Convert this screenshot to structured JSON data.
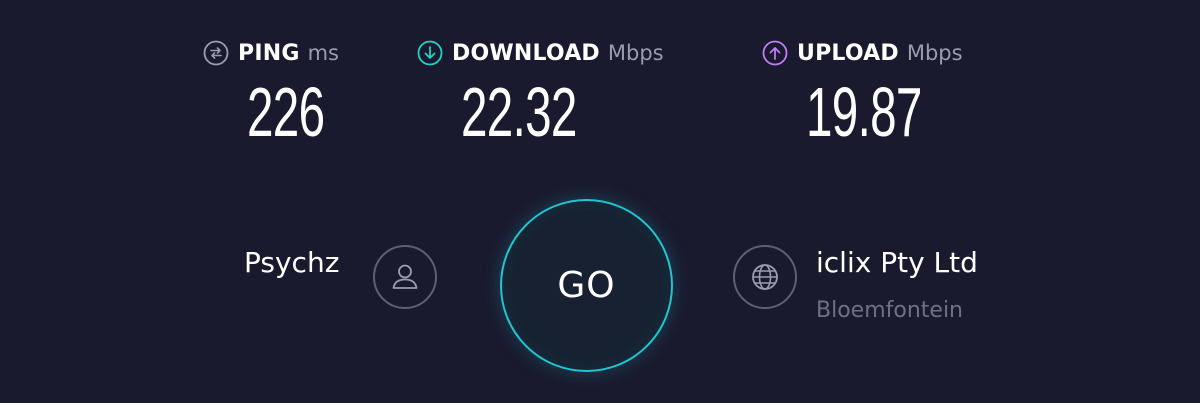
{
  "metrics": {
    "ping": {
      "label": "PING",
      "unit": "ms",
      "value": "226",
      "icon": "ping-icon",
      "color": "#9a9caf"
    },
    "download": {
      "label": "DOWNLOAD",
      "unit": "Mbps",
      "value": "22.32",
      "icon": "download-arrow-icon",
      "color": "#1fd3c6"
    },
    "upload": {
      "label": "UPLOAD",
      "unit": "Mbps",
      "value": "19.87",
      "icon": "upload-arrow-icon",
      "color": "#c17cf5"
    }
  },
  "host": {
    "name": "Psychz",
    "icon": "user-icon"
  },
  "go_button": {
    "label": "GO",
    "ring_color": "#1fc6d2"
  },
  "isp": {
    "name": "iclix Pty Ltd",
    "location": "Bloemfontein",
    "icon": "globe-icon"
  },
  "theme": {
    "background": "#1a1a2e",
    "text": "#ffffff",
    "muted": "#9a9caf"
  }
}
